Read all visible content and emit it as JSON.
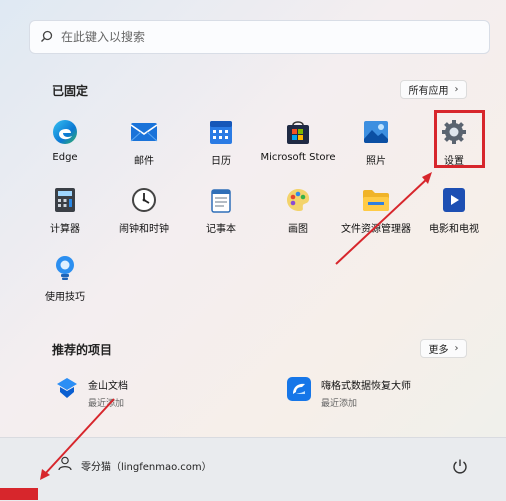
{
  "search": {
    "placeholder": "在此键入以搜索"
  },
  "pinned": {
    "title": "已固定",
    "all_apps_label": "所有应用",
    "apps": [
      {
        "label": "Edge",
        "icon": "edge-icon"
      },
      {
        "label": "邮件",
        "icon": "mail-icon"
      },
      {
        "label": "日历",
        "icon": "calendar-icon"
      },
      {
        "label": "Microsoft Store",
        "icon": "store-icon"
      },
      {
        "label": "照片",
        "icon": "photos-icon"
      },
      {
        "label": "设置",
        "icon": "gear-icon"
      },
      {
        "label": "计算器",
        "icon": "calculator-icon"
      },
      {
        "label": "闹钟和时钟",
        "icon": "clock-icon"
      },
      {
        "label": "记事本",
        "icon": "notepad-icon"
      },
      {
        "label": "画图",
        "icon": "paint-icon"
      },
      {
        "label": "文件资源管理器",
        "icon": "folder-icon"
      },
      {
        "label": "电影和电视",
        "icon": "video-icon"
      },
      {
        "label": "使用技巧",
        "icon": "tips-icon"
      }
    ]
  },
  "recommended": {
    "title": "推荐的项目",
    "more_label": "更多",
    "items": [
      {
        "name": "金山文档",
        "sub": "最近添加",
        "icon": "kdocs-icon"
      },
      {
        "name": "嗨格式数据恢复大师",
        "sub": "最近添加",
        "icon": "data-recovery-icon"
      }
    ]
  },
  "footer": {
    "user_name": "零分猫（lingfenmao.com）"
  },
  "colors": {
    "highlight": "#d7262c",
    "accent": "#0067c0"
  }
}
